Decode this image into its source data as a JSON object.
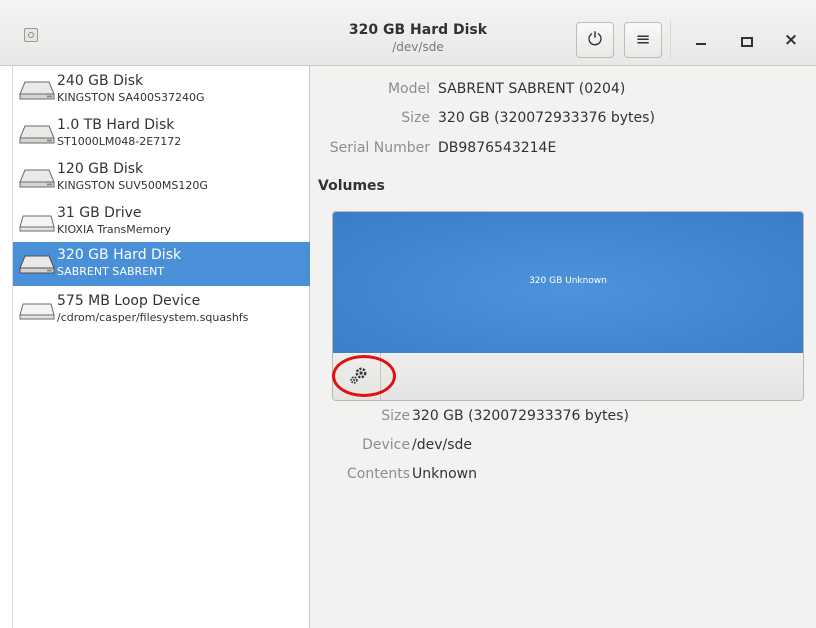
{
  "header": {
    "title": "320 GB Hard Disk",
    "subtitle": "/dev/sde",
    "power_icon": "⏻",
    "menu_icon": "≡",
    "close_icon": "×"
  },
  "sidebar": {
    "items": [
      {
        "name": "240 GB Disk",
        "model": "KINGSTON SA400S37240G"
      },
      {
        "name": "1.0 TB Hard Disk",
        "model": "ST1000LM048-2E7172"
      },
      {
        "name": "120 GB Disk",
        "model": "KINGSTON SUV500MS120G"
      },
      {
        "name": "31 GB Drive",
        "model": "KIOXIA TransMemory"
      },
      {
        "name": "320 GB Hard Disk",
        "model": "SABRENT SABRENT"
      },
      {
        "name": "575 MB Loop Device",
        "model": "/cdrom/casper/filesystem.squashfs"
      }
    ]
  },
  "drive": {
    "model_label": "Model",
    "model_value": "SABRENT SABRENT (0204)",
    "size_label": "Size",
    "size_value": "320 GB (320072933376 bytes)",
    "serial_label": "Serial Number",
    "serial_value": "DB9876543214E"
  },
  "volumes": {
    "title": "Volumes",
    "partition_label": "320 GB Unknown",
    "size_label": "Size",
    "size_value": "320 GB (320072933376 bytes)",
    "device_label": "Device",
    "device_value": "/dev/sde",
    "contents_label": "Contents",
    "contents_value": "Unknown"
  },
  "colors": {
    "selection": "#4a90d9",
    "partition": "#3f83cf",
    "highlight_ring": "#e3100e"
  }
}
